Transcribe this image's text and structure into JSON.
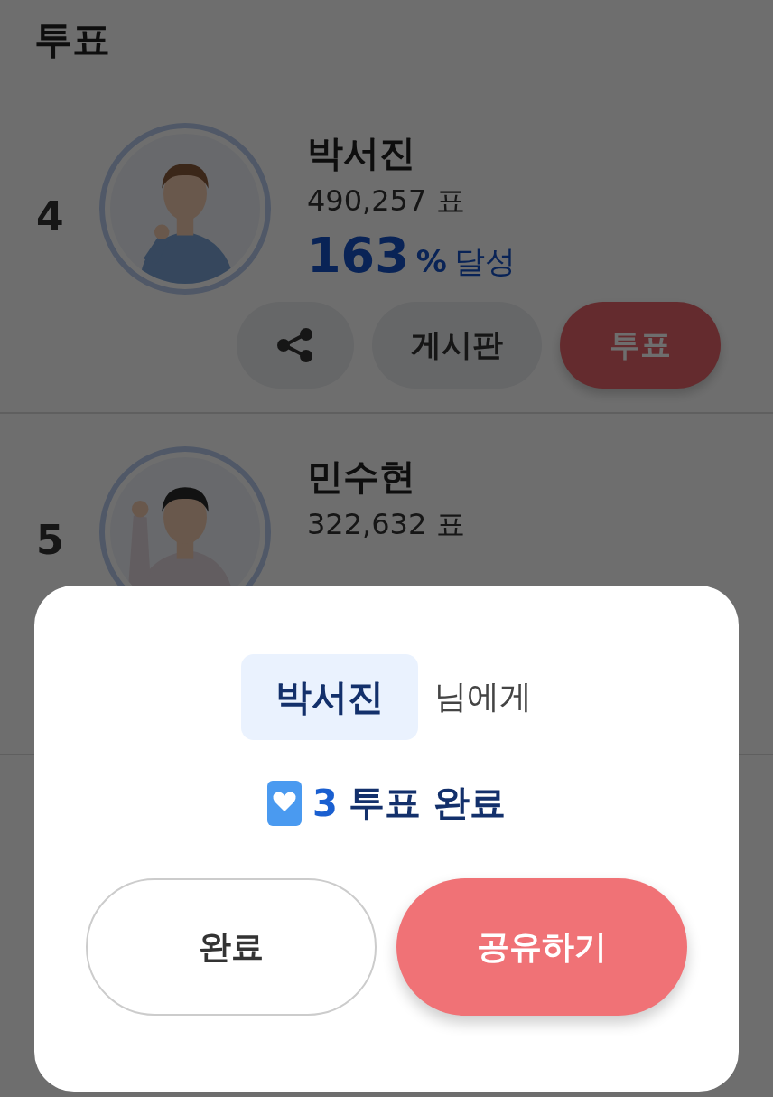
{
  "header": {
    "title": "투표"
  },
  "candidates": [
    {
      "rank": "4",
      "name": "박서진",
      "votes": "490,257 표",
      "percent": "163",
      "percent_unit": "%",
      "percent_label": "달성",
      "buttons": [
        {
          "kind": "share"
        },
        {
          "kind": "board",
          "label": "게시판"
        },
        {
          "kind": "vote",
          "label": "투표"
        }
      ]
    },
    {
      "rank": "5",
      "name": "민수현",
      "votes": "322,632 표"
    }
  ],
  "dialog": {
    "recipient": "박서진",
    "recipient_suffix": "님에게",
    "count": "3",
    "message": "투표 완료",
    "buttons": [
      {
        "kind": "close",
        "label": "완료"
      },
      {
        "kind": "share",
        "label": "공유하기"
      }
    ]
  }
}
